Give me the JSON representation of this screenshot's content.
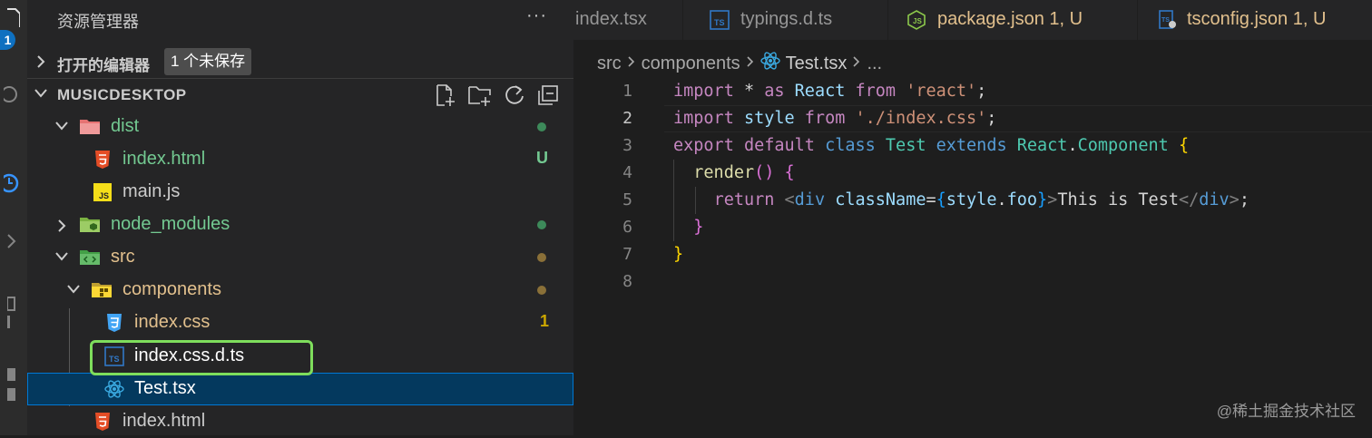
{
  "activity_bar": {
    "badge": "1"
  },
  "sidebar": {
    "title": "资源管理器",
    "more_label": "···",
    "open_editors": {
      "label": "打开的编辑器",
      "badge": "1 个未保存"
    },
    "project": {
      "label": "MUSICDESKTOP"
    },
    "tree": [
      {
        "label": "dist",
        "icon": "folder-dist-icon",
        "color": "#73c991",
        "status": "dot",
        "status_color": "#3d8a5a"
      },
      {
        "label": "index.html",
        "icon": "html-icon",
        "color": "#73c991",
        "status": "U",
        "status_color": "#73c991"
      },
      {
        "label": "main.js",
        "icon": "js-icon",
        "color": "#cccccc"
      },
      {
        "label": "node_modules",
        "icon": "folder-node-icon",
        "color": "#73c991",
        "status": "dot",
        "status_color": "#3d8a5a"
      },
      {
        "label": "src",
        "icon": "folder-src-icon",
        "color": "#e2c08d",
        "status": "dot",
        "status_color": "#8a7038"
      },
      {
        "label": "components",
        "icon": "folder-components-icon",
        "color": "#e2c08d",
        "status": "dot",
        "status_color": "#8a7038"
      },
      {
        "label": "index.css",
        "icon": "css-icon",
        "color": "#e2c08d",
        "status": "1",
        "status_color": "#cca700"
      },
      {
        "label": "index.css.d.ts",
        "icon": "ts-icon",
        "color": "#ffffff"
      },
      {
        "label": "Test.tsx",
        "icon": "react-icon",
        "color": "#ffffff"
      },
      {
        "label": "index.html",
        "icon": "html-icon",
        "color": "#cccccc"
      }
    ]
  },
  "tabs": [
    {
      "label": "index.tsx",
      "color": "#969696"
    },
    {
      "label": "typings.d.ts",
      "color": "#969696"
    },
    {
      "label": "package.json 1, U",
      "color": "#e2c08d"
    },
    {
      "label": "tsconfig.json 1, U",
      "color": "#e2c08d"
    }
  ],
  "breadcrumb": {
    "segments": [
      "src",
      "components",
      "Test.tsx",
      "..."
    ]
  },
  "editor": {
    "line_numbers": [
      "1",
      "2",
      "3",
      "4",
      "5",
      "6",
      "7",
      "8"
    ],
    "active_line": "2",
    "lines": {
      "l1": {
        "t1": "import",
        "t2": " * ",
        "t3": "as",
        "t4": " React ",
        "t5": "from",
        "t6": " ",
        "t7": "'react'",
        "t8": ";"
      },
      "l2": {
        "t1": "import",
        "t2": " style ",
        "t3": "from",
        "t4": " ",
        "t5": "'./index.css'",
        "t6": ";"
      },
      "l3": {
        "t1": "export",
        "t2": " ",
        "t3": "default",
        "t4": " ",
        "t5": "class",
        "t6": " ",
        "t7": "Test",
        "t8": " ",
        "t9": "extends",
        "t10": " ",
        "t11": "React",
        "t12": ".",
        "t13": "Component",
        "t14": " ",
        "t15": "{"
      },
      "l4": {
        "t1": "  ",
        "t2": "render",
        "t3": "()",
        "t4": " ",
        "t5": "{"
      },
      "l5": {
        "t1": "    ",
        "t2": "return",
        "t3": " ",
        "t4": "<",
        "t5": "div",
        "t6": " ",
        "t7": "className",
        "t8": "=",
        "t9": "{",
        "t10": "style",
        "t11": ".",
        "t12": "foo",
        "t13": "}",
        "t14": ">",
        "t15": "This is Test",
        "t16": "</",
        "t17": "div",
        "t18": ">",
        "t19": ";"
      },
      "l6": {
        "t1": "  ",
        "t2": "}"
      },
      "l7": {
        "t1": "}"
      }
    }
  },
  "watermark": "@稀土掘金技术社区"
}
